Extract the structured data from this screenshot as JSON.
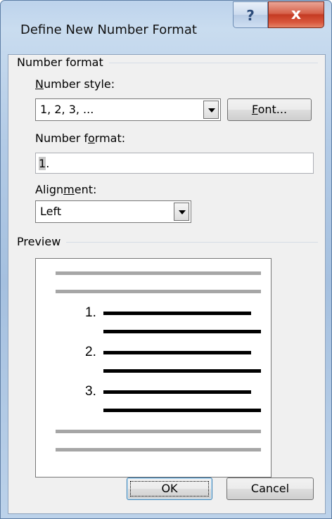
{
  "window": {
    "title": "Define New Number Format",
    "help_glyph": "?",
    "close_glyph": "x"
  },
  "number_format_group": {
    "label": "Number format",
    "number_style": {
      "label_hotkey": "N",
      "label_rest": "umber style:",
      "value": "1, 2, 3, ..."
    },
    "font_button": {
      "label_hotkey": "F",
      "label_rest": "ont..."
    },
    "number_format": {
      "label_pre": "Number f",
      "label_hotkey": "o",
      "label_post": "rmat:",
      "value_selected": "1",
      "value_rest": "."
    },
    "alignment": {
      "label_pre": "Align",
      "label_hotkey": "m",
      "label_post": "ent:",
      "value": "Left"
    }
  },
  "preview": {
    "label": "Preview",
    "items": [
      "1.",
      "2.",
      "3."
    ]
  },
  "buttons": {
    "ok": "OK",
    "cancel": "Cancel"
  }
}
